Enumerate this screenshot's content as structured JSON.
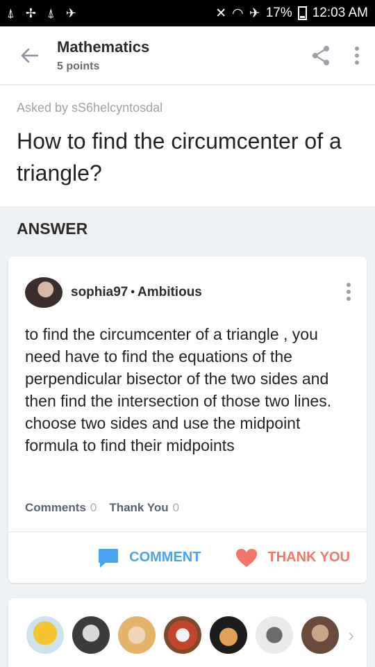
{
  "status": {
    "battery": "17%",
    "time": "12:03 AM"
  },
  "header": {
    "subject": "Mathematics",
    "points": "5 points"
  },
  "question": {
    "asked_by": "Asked by sS6helcyntosdal",
    "text": "How to find the circumcenter of a triangle?"
  },
  "answer": {
    "heading": "ANSWER",
    "author": "sophia97",
    "separator": "•",
    "rank": "Ambitious",
    "text": "to find the circumcenter of a triangle , you need have to find the equations of the perpendicular bisector of the two sides and then find the intersection of those two lines. choose two sides and use the midpoint formula to find their midpoints",
    "comments_label": "Comments",
    "comments_count": "0",
    "thanks_label": "Thank You",
    "thanks_count": "0",
    "comment_button": "COMMENT",
    "thank_button": "THANK YOU"
  },
  "colors": {
    "comment_blue": "#4aa3f0",
    "thank_red": "#f2766a"
  },
  "icons": [
    "back-arrow-icon",
    "share-icon",
    "more-vert-icon",
    "comment-icon",
    "heart-icon",
    "chevron-right-icon"
  ]
}
